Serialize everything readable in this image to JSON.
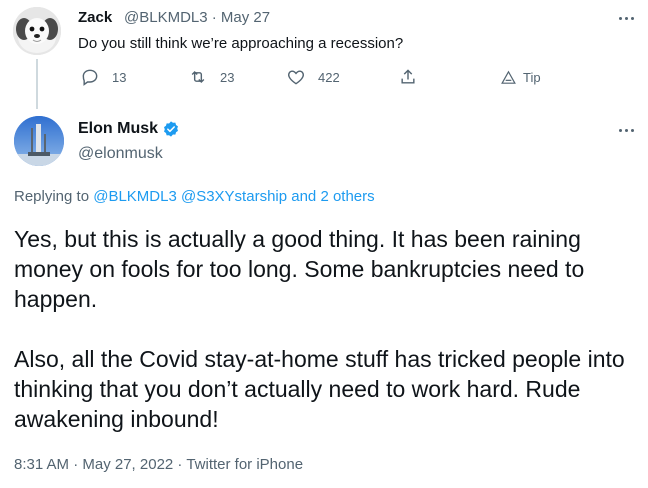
{
  "reply_tweet": {
    "author_name": "Zack",
    "handle_and_date": "@BLKMDL3 · May 27",
    "text": "Do you still think we’re approaching a recession?",
    "actions": {
      "reply_count": "13",
      "retweet_count": "23",
      "like_count": "422",
      "tip_label": "Tip"
    }
  },
  "main_tweet": {
    "author_name": "Elon Musk",
    "handle": "@elonmusk",
    "replying_prefix": "Replying to",
    "replying_to": "@BLKMDL3 @S3XYstarship and 2 others",
    "paragraph_1": "Yes, but this is actually a good thing. It has been raining money on fools for too long. Some bankruptcies need to happen.",
    "paragraph_2": "Also, all the Covid stay-at-home stuff has tricked people into thinking that you don’t actually need to work hard. Rude awakening inbound!",
    "meta": "8:31 AM · May 27, 2022 · Twitter for iPhone"
  },
  "colors": {
    "link": "#1d9bf0",
    "secondary_text": "#536471",
    "verified_badge": "#1d9bf0"
  }
}
